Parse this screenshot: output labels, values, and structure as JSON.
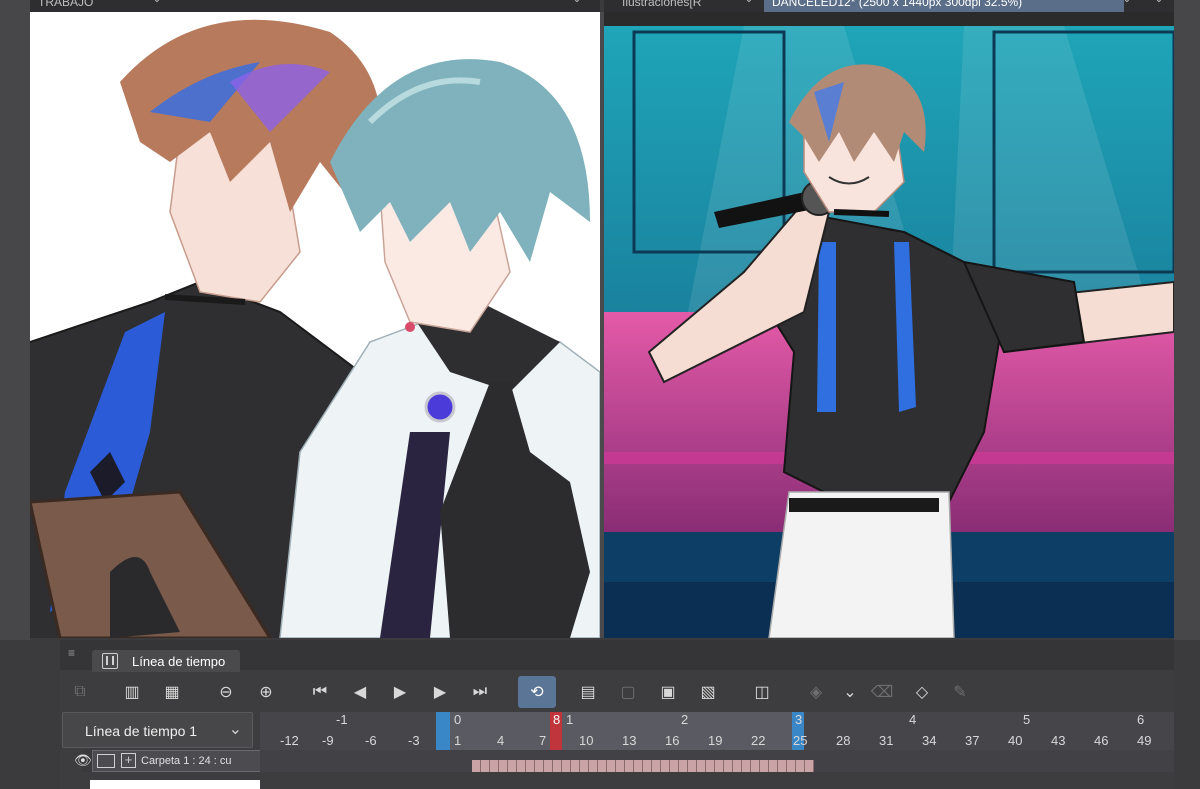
{
  "tabs": {
    "left_tab": "TRABAJO",
    "right_tab_inactive": "Ilustraciones[R",
    "right_tab_active": "DANCELED12* (2500 x 1440px 300dpi 32.5%)"
  },
  "timeline": {
    "panel_tab_label": "Línea de tiempo",
    "selector_value": "Línea de tiempo 1",
    "toolbar_icons": [
      "onion-skin-icon",
      "new-animation-folder-icon",
      "new-animation-cel-icon",
      "zoom-out-icon",
      "zoom-in-icon",
      "go-to-first-frame-icon",
      "previous-frame-icon",
      "play-icon",
      "next-frame-icon",
      "go-to-last-frame-icon",
      "loop-playback-icon",
      "new-cel-icon",
      "delete-cel-icon",
      "cel-specify-icon",
      "cel-specify-sound-icon",
      "light-table-icon",
      "add-tween-icon",
      "dropdown-icon",
      "delete-frame-icon",
      "keyframe-icon",
      "pen-icon"
    ],
    "ruler_seconds": [
      "-1",
      "0",
      "1",
      "2",
      "3",
      "4",
      "5",
      "6"
    ],
    "ruler_frames": [
      "-12",
      "-9",
      "-6",
      "-3",
      "1",
      "4",
      "7",
      "10",
      "13",
      "16",
      "19",
      "22",
      "25",
      "28",
      "31",
      "34",
      "37",
      "40",
      "43",
      "46",
      "49"
    ],
    "playhead_frame": "8",
    "layer": {
      "name": "Carpeta 1 : 24 : cu"
    }
  }
}
